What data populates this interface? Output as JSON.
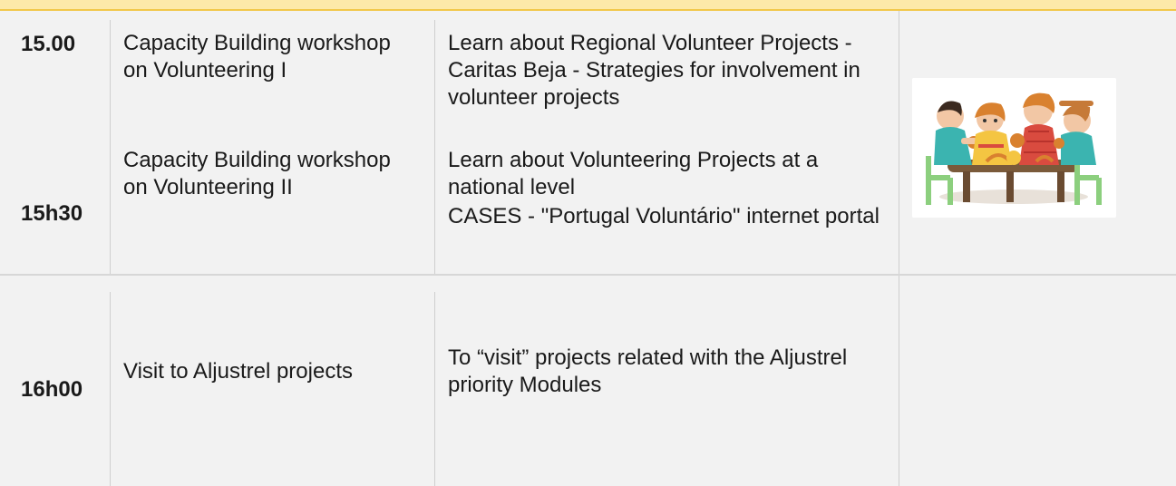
{
  "rows": [
    {
      "time": "15.00",
      "activity": "Capacity Building workshop on Volunteering I",
      "description": "Learn about Regional Volunteer Projects - Caritas Beja - Strategies for involvement in volunteer projects"
    },
    {
      "time": "15h30",
      "activity": "Capacity Building workshop on Volunteering II",
      "description_line1": "Learn about Volunteering Projects at a national level",
      "description_line2": "CASES - \"Portugal Voluntário\" internet portal"
    },
    {
      "time": "16h00",
      "activity": "Visit to Aljustrel projects",
      "description": "To “visit” projects related with the Aljustrel priority Modules"
    }
  ],
  "illustration": {
    "icon": "people-at-table-illustration",
    "colors": {
      "table": "#7a5a3a",
      "chair": "#8ccf7e",
      "hair_dark": "#3b2a20",
      "hair_orange": "#d9812f",
      "shirt_red": "#d94b3f",
      "shirt_teal": "#3bb4b0",
      "shirt_yellow": "#f4c542",
      "skin": "#f2c7a5"
    }
  },
  "colors": {
    "band": "#fde9a9",
    "band_border": "#f2c84b",
    "row_shade": "#f2f2f2",
    "divider": "#cfcfcf"
  }
}
